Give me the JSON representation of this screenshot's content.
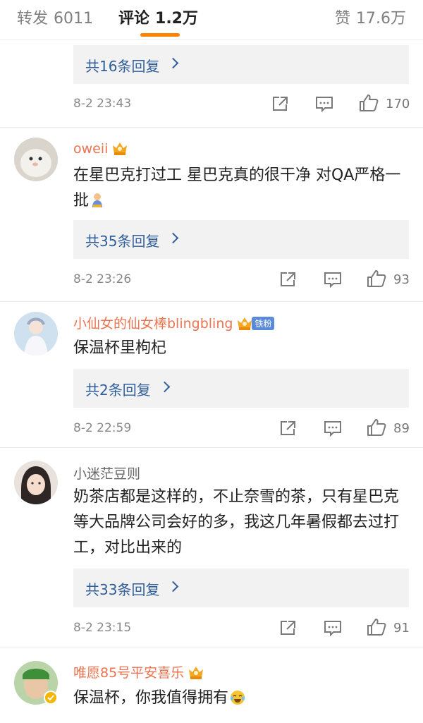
{
  "tabs": {
    "repost_label": "转发",
    "repost_count": "6011",
    "comment_label": "评论",
    "comment_count": "1.2万",
    "like_label": "赞",
    "like_count": "17.6万"
  },
  "colors": {
    "accent": "#ff8200",
    "link": "#2f5e9b",
    "username_vip": "#eb7350"
  },
  "comments": [
    {
      "reply_label": "共16条回复",
      "time": "8-2 23:43",
      "likes": "170"
    },
    {
      "user": "oweii",
      "text": "在星巴克打过工 星巴克真的很干净 对QA严格一批",
      "emoji": "person-icon",
      "reply_label": "共35条回复",
      "time": "8-2 23:26",
      "likes": "93"
    },
    {
      "user": "小仙女的仙女棒blingbling",
      "badge": "铁粉",
      "text": "保温杯里枸杞",
      "reply_label": "共2条回复",
      "time": "8-2 22:59",
      "likes": "89"
    },
    {
      "user": "小迷茫豆则",
      "text": "奶茶店都是这样的，不止奈雪的茶，只有星巴克等大品牌公司会好的多，我这几年暑假都去过打工，对比出来的",
      "reply_label": "共33条回复",
      "time": "8-2 23:15",
      "likes": "91"
    },
    {
      "user": "唯愿85号平安喜乐",
      "text": "保温杯，你我值得拥有",
      "emoji": "laugh-cry-icon"
    }
  ]
}
